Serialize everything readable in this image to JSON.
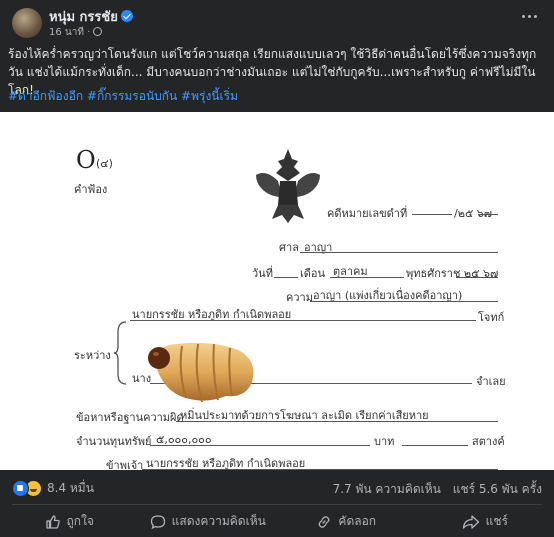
{
  "post": {
    "author": "หนุ่ม กรรชัย",
    "time": "16 นาที",
    "text": "ร้องไห้คร่ำครวญว่าโดนรังแก แต่โชว์ความสถุล เรียกแสงแบบเลวๆ ใช้วิธีด่าคนอื่นโดยไร้ซึ่งความจริงทุกวัน แช่งได้แม้กระทั่งเด็ก... มีบางคนบอกว่าช่างมันเถอะ แต่ไม่ใช่กับกูครับ...เพราะสำหรับกู ค่าฟรีไม่มีในโลก!",
    "hashtags": "#ด่าอีกฟ้องอีก #กิ๊กรรมรอนับกัน #พรุ่งนี้เริ่ม"
  },
  "document": {
    "form_no": "(๔)",
    "form_title": "คำฟ้อง",
    "case_label": "คดีหมายเลขดำที่",
    "case_suffix": "/๒๕ ๖๗",
    "court_label": "ศาล",
    "court_value": "อาญา",
    "date_label": "วันที่",
    "month_label": "เดือน",
    "month_value": "ตุลาคม",
    "year_label": "พุทธศักราช ๒๕ ๖๗",
    "matter_label": "ความ",
    "matter_value": "อาญา (แพ่งเกี่ยวเนื่องคดีอาญา)",
    "between_label": "ระหว่าง",
    "plaintiff_value": "นายกรรชัย หรือภูดิท กำเนิดพลอย",
    "plaintiff_role": "โจทก์",
    "defendant_prefix": "นาง",
    "defendant_role": "จำเลย",
    "charge_label": "ข้อหาหรือฐานความผิด",
    "charge_value": "หมิ่นประมาทด้วยการโฆษณา ละเมิด เรียกค่าเสียหาย",
    "amount_label": "จำนวนทุนทรัพย์",
    "amount_value": "๕,๐๐๐,๐๐๐",
    "baht_label": "บาท",
    "satang_label": "สตางค์",
    "signer_label": "ข้าพเจ้า",
    "signer_value": "นายกรรชัย หรือภูดิท กำเนิดพลอย"
  },
  "stats": {
    "reactions": "8.4 หมื่น",
    "comments": "7.7 พัน ความคิดเห็น",
    "shares": "แชร์ 5.6 พัน ครั้ง"
  },
  "actions": {
    "like": "ถูกใจ",
    "comment": "แสดงความคิดเห็น",
    "copy": "คัดลอก",
    "share": "แชร์"
  },
  "colors": {
    "background": "#242526",
    "link": "#4599ff",
    "like_blue": "#2078f4"
  }
}
